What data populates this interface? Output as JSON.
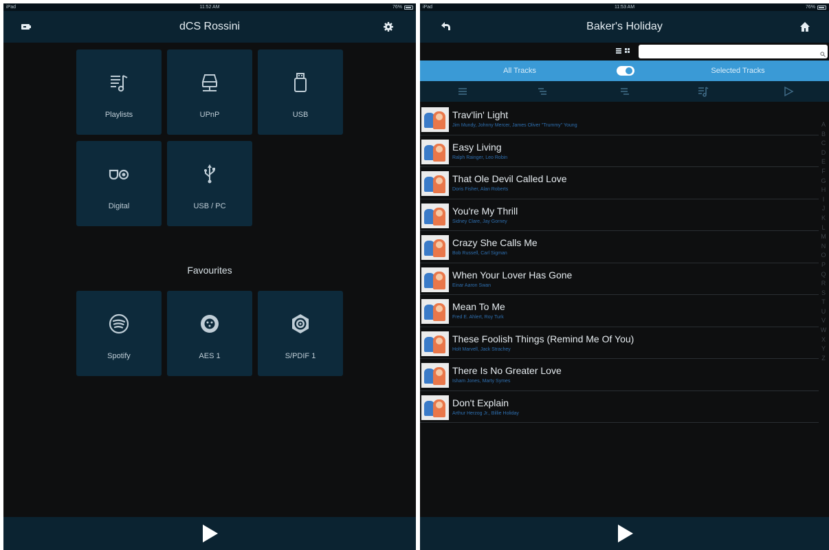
{
  "left_screen": {
    "status": {
      "carrier": "iPad",
      "time": "11:52 AM",
      "battery": "76%"
    },
    "title": "dCS Rossini",
    "sources": [
      {
        "label": "Playlists",
        "icon": "playlist-icon"
      },
      {
        "label": "UPnP",
        "icon": "network-drive-icon"
      },
      {
        "label": "USB",
        "icon": "usb-drive-icon"
      },
      {
        "label": "Digital",
        "icon": "digital-input-icon"
      },
      {
        "label": "USB / PC",
        "icon": "usb-symbol-icon"
      }
    ],
    "favourites_heading": "Favourites",
    "favourites": [
      {
        "label": "Spotify",
        "icon": "spotify-icon"
      },
      {
        "label": "AES 1",
        "icon": "xlr-connector-icon"
      },
      {
        "label": "S/PDIF 1",
        "icon": "coaxial-connector-icon"
      }
    ]
  },
  "right_screen": {
    "status": {
      "carrier": "iPad",
      "time": "11:53 AM",
      "battery": "76%"
    },
    "title": "Baker's Holiday",
    "search": {
      "placeholder": "",
      "value": ""
    },
    "filter": {
      "all_label": "All Tracks",
      "selected_label": "Selected Tracks",
      "toggle_on": true
    },
    "tracks": [
      {
        "title": "Trav'lin' Light",
        "artists": "Jim Mundy, Johnny Mercer, James Oliver \"Trummy\" Young"
      },
      {
        "title": "Easy Living",
        "artists": "Ralph Rainger, Leo Robin"
      },
      {
        "title": "That Ole Devil Called Love",
        "artists": "Doris Fisher, Alan Roberts"
      },
      {
        "title": "You're My Thrill",
        "artists": "Sidney Clare, Jay Gorney"
      },
      {
        "title": "Crazy She Calls Me",
        "artists": "Bob Russell, Carl Sigman"
      },
      {
        "title": "When Your Lover Has Gone",
        "artists": "Einar Aaron Swan"
      },
      {
        "title": "Mean To Me",
        "artists": "Fred E. Ahlert, Roy Turk"
      },
      {
        "title": "These Foolish Things (Remind Me Of You)",
        "artists": "Holt Marvell, Jack Strachey"
      },
      {
        "title": "There Is No Greater Love",
        "artists": "Isham Jones, Marty Symes"
      },
      {
        "title": "Don't Explain",
        "artists": "Arthur Herzog Jr., Billie Holiday"
      }
    ],
    "alphabet": [
      "A",
      "B",
      "C",
      "D",
      "E",
      "F",
      "G",
      "H",
      "I",
      "J",
      "K",
      "L",
      "M",
      "N",
      "O",
      "P",
      "Q",
      "R",
      "S",
      "T",
      "U",
      "V",
      "W",
      "X",
      "Y",
      "Z"
    ]
  },
  "colors": {
    "bar_dark": "#0b2331",
    "tile": "#0d2a3b",
    "accent_blue": "#3a9ad6",
    "artist_text": "#2e6fb0",
    "background": "#0e0f10"
  }
}
